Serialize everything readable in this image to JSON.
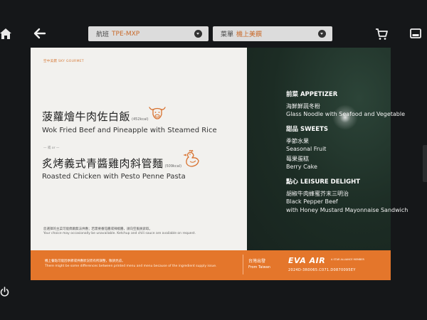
{
  "topbar": {
    "flight_label": "航班",
    "flight_value": "TPE-MXP",
    "menu_label": "菜單",
    "menu_value": "機上美饌"
  },
  "card": {
    "brand_tag": "空中美饌 SKY GOURMET",
    "dish1": {
      "zh": "菠蘿燴牛肉佐白飯",
      "kcal": "(452kcal)",
      "en": "Wok Fried Beef and Pineapple with Steamed Rice"
    },
    "or_divider": "— 或 or —",
    "dish2": {
      "zh": "炙烤義式青醬雞肉斜管麵",
      "kcal": "(509kcal)",
      "en": "Roasted Chicken with Pesto Penne Pasta"
    },
    "note_zh": "您選擇的主菜可能偶爾無法供應；若需要番茄醬或辣椒醬，請向空服員索取。",
    "note_en": "Your choice may occasionally be unavailable. Ketchup and chili sauce are available on request.",
    "appetizer_title": "前菜  APPETIZER",
    "appetizer_zh": "海鮮鮮蔬冬粉",
    "appetizer_en": "Glass Noodle with Seafood and Vegetable",
    "sweets_title": "甜品  SWEETS",
    "sweets_1_zh": "季節水果",
    "sweets_1_en": "Seasonal Fruit",
    "sweets_2_zh": "莓果蛋糕",
    "sweets_2_en": "Berry Cake",
    "leisure_title": "點心  LEISURE DELIGHT",
    "leisure_zh": "胡椒牛肉蜂蜜芥末三明治",
    "leisure_en_1": "Black Pepper Beef",
    "leisure_en_2": "with Honey Mustard Mayonnaise Sandwich",
    "band_zh": "機上餐點可能因季節或供應狀況而有所調整，敬請見諒。",
    "band_en": "There might be some differences between printed menu and menu because of the ingredient supply issue.",
    "origin_zh": "台灣出發",
    "origin_en": "From Taiwan",
    "airline_logo": "EVA AIR",
    "alliance_text": "A STAR ALLIANCE MEMBER",
    "menu_code": "2024D-3R0065.C071.D0870095EY"
  },
  "colors": {
    "accent_orange": "#e4762b",
    "panel_green": "#1c2c24",
    "card_white": "#f2f1ee"
  },
  "icons": [
    "home-icon",
    "back-arrow-icon",
    "cart-icon",
    "screen-icon",
    "power-icon",
    "beef-icon",
    "chicken-icon"
  ]
}
